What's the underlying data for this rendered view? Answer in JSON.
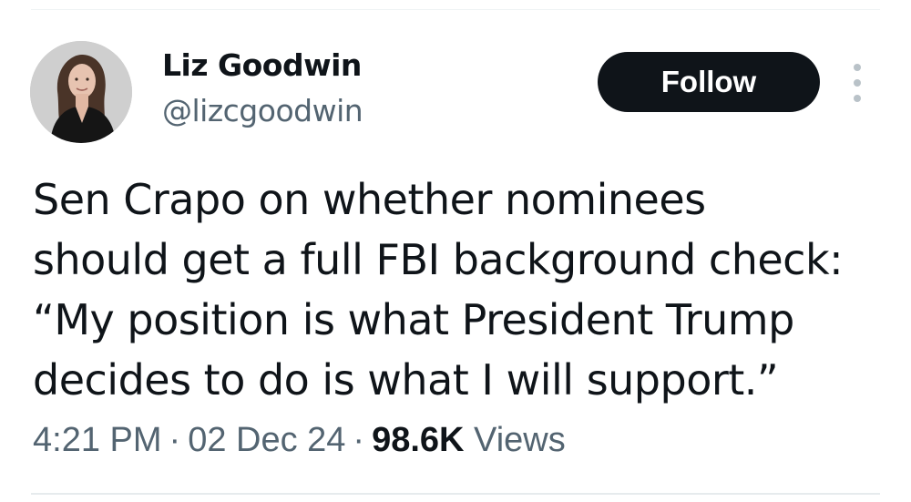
{
  "author": {
    "display_name": "Liz Goodwin",
    "handle": "@lizcgoodwin",
    "avatar_icon": "profile-photo"
  },
  "follow_button": {
    "label": "Follow"
  },
  "more_menu": {
    "icon": "more-vertical-icon"
  },
  "tweet": {
    "text": "Sen Crapo on whether nominees\nshould get a full FBI background check:\n“My position is what President Trump\ndecides to do is what I will support.”"
  },
  "meta": {
    "time": "4:21 PM",
    "separator": "·",
    "date": "02 Dec 24",
    "views_count": "98.6K",
    "views_label": "Views"
  },
  "colors": {
    "text_primary": "#0f1419",
    "text_secondary": "#536471",
    "button_bg": "#0f1419",
    "button_text": "#ffffff",
    "divider": "#eff3f4"
  }
}
